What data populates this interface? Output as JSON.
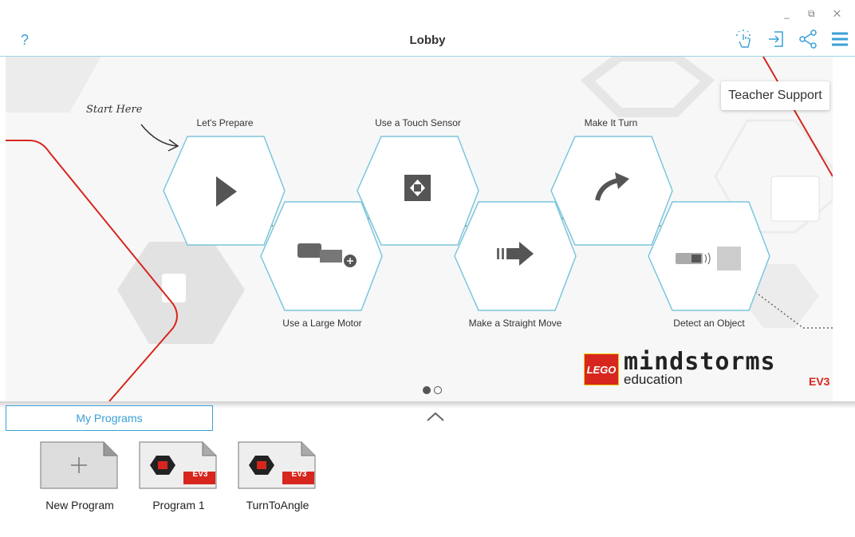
{
  "window": {
    "controls": "_ ⧉ ✕"
  },
  "header": {
    "help": "?",
    "title": "Lobby"
  },
  "tooltip": "Teacher Support",
  "lobby": {
    "start_here": "Start Here",
    "missions": [
      {
        "label": "Let's Prepare",
        "icon": "play-icon"
      },
      {
        "label": "Use a Large Motor",
        "icon": "large-motor-icon"
      },
      {
        "label": "Use a Touch Sensor",
        "icon": "touch-sensor-icon"
      },
      {
        "label": "Make a Straight Move",
        "icon": "straight-arrow-icon"
      },
      {
        "label": "Make It Turn",
        "icon": "turn-arrow-icon"
      },
      {
        "label": "Detect an Object",
        "icon": "ultrasonic-sensor-icon"
      }
    ],
    "page_indicator": {
      "current": 1,
      "total": 2
    }
  },
  "brand": {
    "lego": "LEGO",
    "mindstorms": "mindstorms",
    "education": "education",
    "ev3": "EV3"
  },
  "programs": {
    "tab": "My Programs",
    "items": [
      {
        "label": "New Program",
        "type": "new"
      },
      {
        "label": "Program 1",
        "type": "ev3"
      },
      {
        "label": "TurnToAngle",
        "type": "ev3"
      }
    ],
    "badge": "EV3"
  },
  "colors": {
    "accent": "#3aa0d6",
    "path_red": "#d7261e",
    "hex_border": "#7cc6dc"
  }
}
